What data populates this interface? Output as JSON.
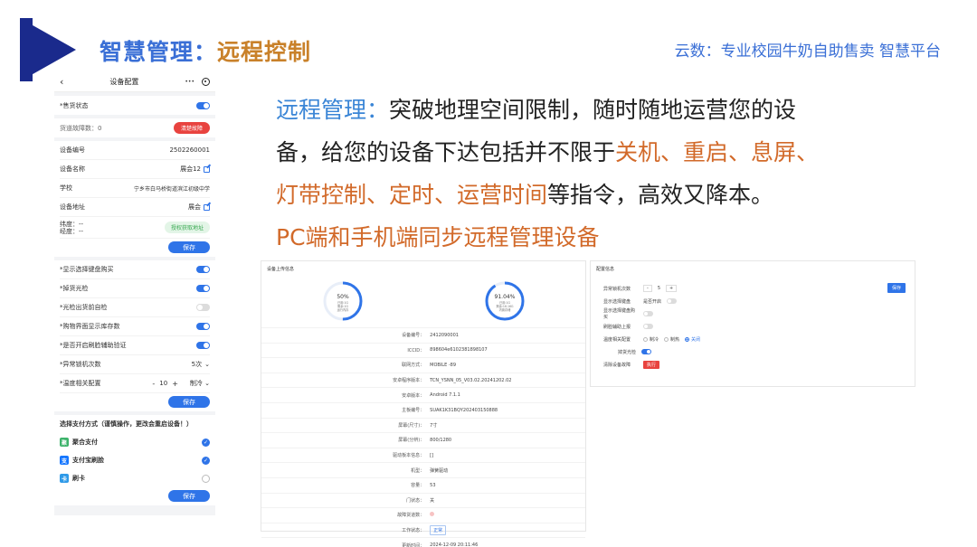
{
  "header": {
    "title_part1": "智慧管理：",
    "title_part2": "远程控制",
    "slogan": "云数：专业校园牛奶自助售卖 智慧平台"
  },
  "phone": {
    "nav_title": "设备配置",
    "nav_back": "‹",
    "nav_more": "•••",
    "card1": {
      "sale_status": "*售货状态"
    },
    "card2": {
      "fault_label": "货道故障数：0",
      "clear_fault_button": "清楚故障"
    },
    "card3": {
      "rows": [
        {
          "label": "设备编号",
          "value": "2502260001"
        },
        {
          "label": "设备名称",
          "value": "展会12"
        },
        {
          "label": "学校",
          "value": "宁乡市白马桥街道滨江初级中学"
        },
        {
          "label": "设备地址",
          "value": "展会"
        }
      ],
      "lat_label": "纬度：--",
      "lng_label": "经度：--",
      "get_location_button": "授权获取地址",
      "save_button": "保存"
    },
    "card4": {
      "rows": [
        {
          "label": "*显示选择键盘购买",
          "toggle": true
        },
        {
          "label": "*掉货光检",
          "toggle": true
        },
        {
          "label": "*光检出货前自检",
          "toggle": false
        },
        {
          "label": "*购物界面显示库存数",
          "toggle": true
        },
        {
          "label": "*是否开启刷脸辅助验证",
          "toggle": true
        }
      ],
      "abnormal_label": "*异常锁机次数",
      "abnormal_value": "5次",
      "temp_label": "*温度相关配置",
      "temp_minus": "-",
      "temp_value": "10",
      "temp_plus": "+",
      "temp_mode": "制冷",
      "save_button": "保存"
    },
    "card5": {
      "title": "选择支付方式（谨慎操作，更改会重启设备！）",
      "items": [
        {
          "label": "聚合支付",
          "checked": true,
          "icon": "聚",
          "color": "#3db36b"
        },
        {
          "label": "支付宝刷脸",
          "checked": true,
          "icon": "支",
          "color": "#1677ff"
        },
        {
          "label": "刷卡",
          "checked": false,
          "icon": "卡",
          "color": "#2f9ae8"
        }
      ],
      "save_button": "保存"
    }
  },
  "main_text": {
    "p1_blue": "远程管理：",
    "p1_a": "突破地理空间限制，随时随地运营您的设",
    "p1_b": "备，给您的设备下达包括并不限于",
    "p1_b_orange": "关机、重启、息屏、",
    "p1_c_orange": "灯带控制、定时、运营时间",
    "p1_c": "等指令，高效又降本。",
    "p2_orange": "PC端和手机端同步远程管理设备"
  },
  "left_panel": {
    "title": "设备上传信息",
    "gauge1": {
      "percent": 0.5,
      "label": "50%",
      "sub1": "已用:1G",
      "sub2": "剩余:1G",
      "sub3": "运行内存"
    },
    "gauge2": {
      "percent": 0.9104,
      "label": "91.04%",
      "sub1": "已用:1G",
      "sub2": "剩余:16.16G",
      "sub3": "内置存储"
    },
    "rows": [
      {
        "k": "设备编号：",
        "v": "2412090001"
      },
      {
        "k": "ICCID：",
        "v": "898604e6102381898107"
      },
      {
        "k": "联网方式：",
        "v": "MOBILE -89"
      },
      {
        "k": "安卓程序版本：",
        "v": "TCN_YSNN_05_V03.02.20241202.02"
      },
      {
        "k": "安卓版本：",
        "v": "Android 7.1.1"
      },
      {
        "k": "主板编号：",
        "v": "SUAK1K31BQY202403150888"
      },
      {
        "k": "屏幕(尺寸)：",
        "v": "7寸"
      },
      {
        "k": "屏幕(分辨)：",
        "v": "800/1280"
      },
      {
        "k": "驱动板本信息：",
        "v": "[]"
      },
      {
        "k": "机型：",
        "v": "弹簧驱动"
      },
      {
        "k": "容量：",
        "v": "53"
      },
      {
        "k": "门状态：",
        "v": "关"
      },
      {
        "k": "故障货道数：",
        "v": "",
        "dot": true
      },
      {
        "k": "工作状态：",
        "v": "正常",
        "tag": true
      },
      {
        "k": "更新时间：",
        "v": "2024-12-09 20:11:46"
      }
    ]
  },
  "right_panel": {
    "title": "配置信息",
    "save_button": "保存",
    "rows": {
      "abnormal_label": "异常锁机次数",
      "abnormal_minus": "-",
      "abnormal_value": "5",
      "abnormal_plus": "+",
      "kb_label": "显示选择键盘",
      "kb_sub": "是否开启",
      "stock_label": "显示选择键盘购买",
      "face_label": "刷脸辅助上报",
      "temp_label": "温度相关配置",
      "temp_opt1": "制冷",
      "temp_opt2": "制热",
      "temp_opt3": "关闭",
      "light_label": "掉货光检",
      "clear_label": "清除设备故障",
      "clear_button": "执行"
    }
  },
  "colors": {
    "brand_blue": "#3a6fd6",
    "accent_orange": "#d26a2a",
    "toggle_blue": "#2f74e8",
    "danger_red": "#e8433f"
  }
}
